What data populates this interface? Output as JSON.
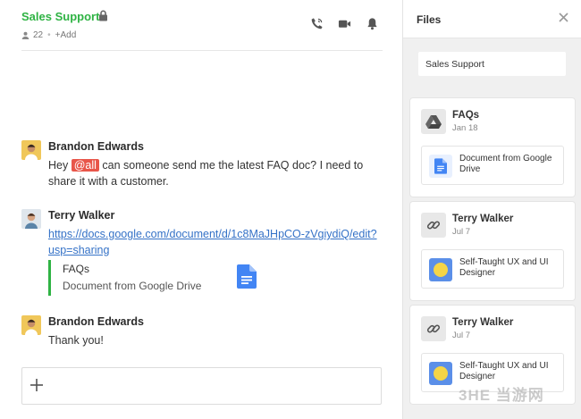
{
  "channel": {
    "name": "Sales Support",
    "member_count": "22",
    "add_label": "+Add"
  },
  "messages": [
    {
      "author": "Brandon Edwards",
      "text_before": "Hey ",
      "mention": "@all",
      "text_after": " can someone send me the latest FAQ doc? I need to share it with a customer."
    },
    {
      "author": "Terry Walker",
      "link": "https://docs.google.com/document/d/1c8MaJHpCO-zVgiydiQ/edit?usp=sharing",
      "attachment": {
        "title": "FAQs",
        "subtitle": "Document from Google Drive"
      }
    },
    {
      "author": "Brandon Edwards",
      "text": "Thank you!"
    }
  ],
  "files_panel": {
    "title": "Files",
    "search_value": "Sales Support",
    "cards": [
      {
        "icon": "google-drive-icon",
        "name": "FAQs",
        "date": "Jan 18",
        "file_icon": "google-doc-icon",
        "file_label": "Document from Google Drive"
      },
      {
        "icon": "link-icon",
        "name": "Terry Walker",
        "date": "Jul 7",
        "file_icon": "yellow-circle-icon",
        "file_label": "Self-Taught UX and UI Designer"
      },
      {
        "icon": "link-icon",
        "name": "Terry Walker",
        "date": "Jul 7",
        "file_icon": "yellow-circle-icon",
        "file_label": "Self-Taught UX and UI Designer"
      }
    ]
  },
  "colors": {
    "accent_green": "#2fb344",
    "mention_red": "#e8564a",
    "link_blue": "#3572c7",
    "doc_blue": "#4285f4",
    "tile_blue": "#5b8fe8",
    "tile_yellow": "#f5d547"
  },
  "watermark": "3HE 当游网"
}
